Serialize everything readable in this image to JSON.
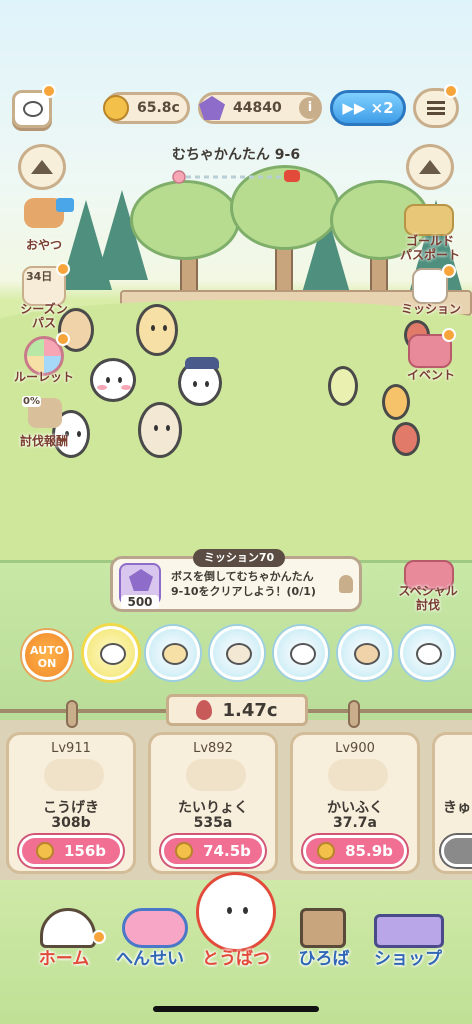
{
  "top_bar": {
    "coins": "65.8c",
    "gems": "44840",
    "info_label": "i",
    "speed_label": "▶▶ ×2"
  },
  "stage": {
    "title": "むちゃかんたん 9-6"
  },
  "left_menu": {
    "snack": "おやつ",
    "season_days": "34日",
    "season_line1": "シーズン",
    "season_line2": "パス",
    "roulette": "ルーレット",
    "reward_pct": "0%",
    "reward": "討伐報酬"
  },
  "right_menu": {
    "gold_line1": "ゴールド",
    "gold_line2": "パスポート",
    "mission": "ミッション",
    "event": "イベント",
    "special_line1": "スペシャル",
    "special_line2": "討伐"
  },
  "mission": {
    "tag": "ミッション70",
    "reward_count": "500",
    "line1": "ボスを倒してむちゃかんたん",
    "line2": "9-10をクリアしよう！(0/1)"
  },
  "auto": {
    "line1": "AUTO",
    "line2": "ON"
  },
  "total_power": "1.47c",
  "upgrades": [
    {
      "level": "Lv911",
      "name": "こうげき",
      "value": "308b",
      "cost": "156b"
    },
    {
      "level": "Lv892",
      "name": "たいりょく",
      "value": "535a",
      "cost": "74.5b"
    },
    {
      "level": "Lv900",
      "name": "かいふく",
      "value": "37.7a",
      "cost": "85.9b"
    },
    {
      "level": "",
      "name": "きゅ",
      "value": "",
      "cost": ""
    }
  ],
  "nav": {
    "home": "ホーム",
    "formation": "へんせい",
    "battle": "とうばつ",
    "plaza": "ひろば",
    "shop": "ショップ"
  },
  "colors": {
    "accent_pink": "#f06f92",
    "accent_blue": "#2f66b5",
    "accent_red": "#e24a3a"
  }
}
